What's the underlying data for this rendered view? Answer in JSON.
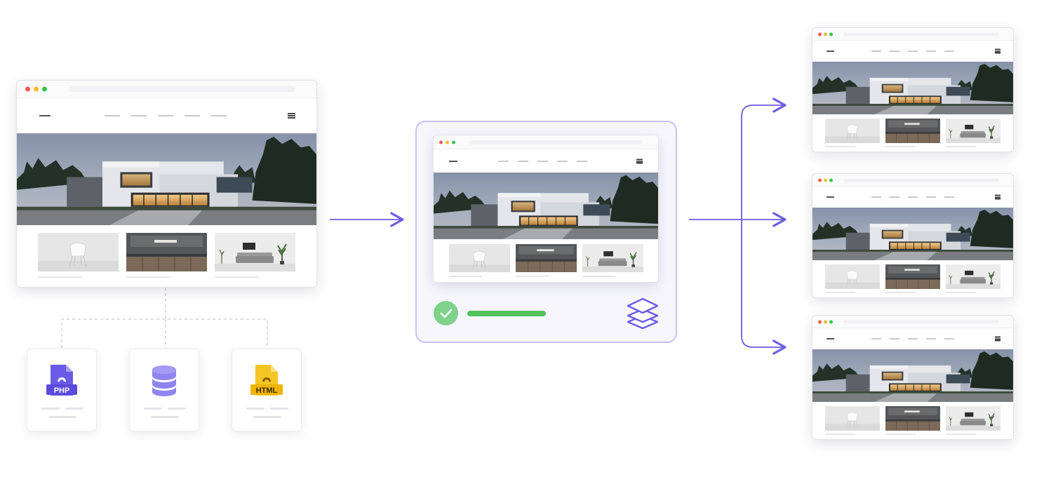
{
  "colors": {
    "accent": "#6b5ce7",
    "accent_light": "#c9c2f7",
    "success": "#53c25f",
    "check_circle": "#7fd18c",
    "php_icon": "#6b5ce7",
    "database_icon": "#8f84f0",
    "html_icon": "#f5c623",
    "connector_dashed": "#d2d2d6"
  },
  "sources": [
    {
      "name": "php-file",
      "icon": "php-file-icon",
      "label": "PHP"
    },
    {
      "name": "database",
      "icon": "database-icon",
      "label": ""
    },
    {
      "name": "html-file",
      "icon": "html-file-icon",
      "label": "HTML"
    }
  ],
  "hub": {
    "status": "check-icon",
    "progress_fraction": 1.0,
    "layers_icon": "layers-icon"
  },
  "outputs_count": 3
}
